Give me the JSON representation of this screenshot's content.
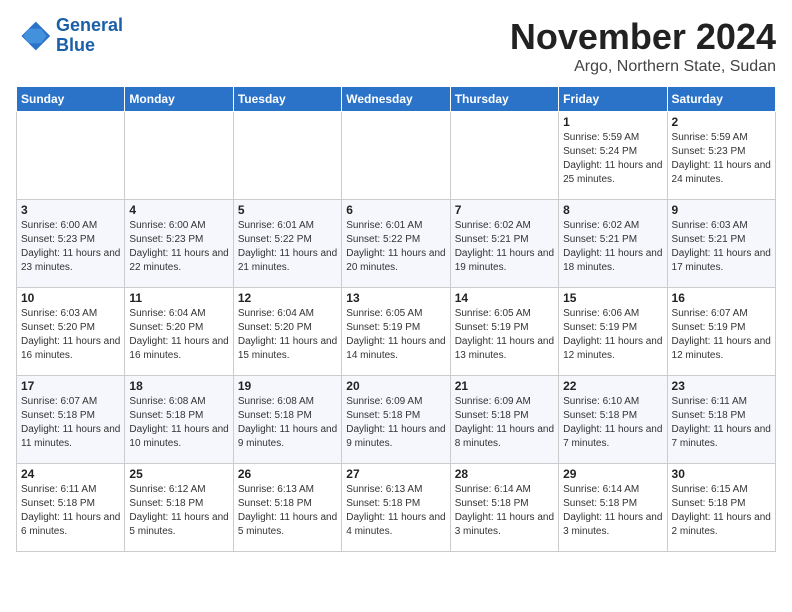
{
  "header": {
    "logo_line1": "General",
    "logo_line2": "Blue",
    "month_title": "November 2024",
    "location": "Argo, Northern State, Sudan"
  },
  "days_of_week": [
    "Sunday",
    "Monday",
    "Tuesday",
    "Wednesday",
    "Thursday",
    "Friday",
    "Saturday"
  ],
  "weeks": [
    [
      {
        "day": "",
        "info": ""
      },
      {
        "day": "",
        "info": ""
      },
      {
        "day": "",
        "info": ""
      },
      {
        "day": "",
        "info": ""
      },
      {
        "day": "",
        "info": ""
      },
      {
        "day": "1",
        "info": "Sunrise: 5:59 AM\nSunset: 5:24 PM\nDaylight: 11 hours and 25 minutes."
      },
      {
        "day": "2",
        "info": "Sunrise: 5:59 AM\nSunset: 5:23 PM\nDaylight: 11 hours and 24 minutes."
      }
    ],
    [
      {
        "day": "3",
        "info": "Sunrise: 6:00 AM\nSunset: 5:23 PM\nDaylight: 11 hours and 23 minutes."
      },
      {
        "day": "4",
        "info": "Sunrise: 6:00 AM\nSunset: 5:23 PM\nDaylight: 11 hours and 22 minutes."
      },
      {
        "day": "5",
        "info": "Sunrise: 6:01 AM\nSunset: 5:22 PM\nDaylight: 11 hours and 21 minutes."
      },
      {
        "day": "6",
        "info": "Sunrise: 6:01 AM\nSunset: 5:22 PM\nDaylight: 11 hours and 20 minutes."
      },
      {
        "day": "7",
        "info": "Sunrise: 6:02 AM\nSunset: 5:21 PM\nDaylight: 11 hours and 19 minutes."
      },
      {
        "day": "8",
        "info": "Sunrise: 6:02 AM\nSunset: 5:21 PM\nDaylight: 11 hours and 18 minutes."
      },
      {
        "day": "9",
        "info": "Sunrise: 6:03 AM\nSunset: 5:21 PM\nDaylight: 11 hours and 17 minutes."
      }
    ],
    [
      {
        "day": "10",
        "info": "Sunrise: 6:03 AM\nSunset: 5:20 PM\nDaylight: 11 hours and 16 minutes."
      },
      {
        "day": "11",
        "info": "Sunrise: 6:04 AM\nSunset: 5:20 PM\nDaylight: 11 hours and 16 minutes."
      },
      {
        "day": "12",
        "info": "Sunrise: 6:04 AM\nSunset: 5:20 PM\nDaylight: 11 hours and 15 minutes."
      },
      {
        "day": "13",
        "info": "Sunrise: 6:05 AM\nSunset: 5:19 PM\nDaylight: 11 hours and 14 minutes."
      },
      {
        "day": "14",
        "info": "Sunrise: 6:05 AM\nSunset: 5:19 PM\nDaylight: 11 hours and 13 minutes."
      },
      {
        "day": "15",
        "info": "Sunrise: 6:06 AM\nSunset: 5:19 PM\nDaylight: 11 hours and 12 minutes."
      },
      {
        "day": "16",
        "info": "Sunrise: 6:07 AM\nSunset: 5:19 PM\nDaylight: 11 hours and 12 minutes."
      }
    ],
    [
      {
        "day": "17",
        "info": "Sunrise: 6:07 AM\nSunset: 5:18 PM\nDaylight: 11 hours and 11 minutes."
      },
      {
        "day": "18",
        "info": "Sunrise: 6:08 AM\nSunset: 5:18 PM\nDaylight: 11 hours and 10 minutes."
      },
      {
        "day": "19",
        "info": "Sunrise: 6:08 AM\nSunset: 5:18 PM\nDaylight: 11 hours and 9 minutes."
      },
      {
        "day": "20",
        "info": "Sunrise: 6:09 AM\nSunset: 5:18 PM\nDaylight: 11 hours and 9 minutes."
      },
      {
        "day": "21",
        "info": "Sunrise: 6:09 AM\nSunset: 5:18 PM\nDaylight: 11 hours and 8 minutes."
      },
      {
        "day": "22",
        "info": "Sunrise: 6:10 AM\nSunset: 5:18 PM\nDaylight: 11 hours and 7 minutes."
      },
      {
        "day": "23",
        "info": "Sunrise: 6:11 AM\nSunset: 5:18 PM\nDaylight: 11 hours and 7 minutes."
      }
    ],
    [
      {
        "day": "24",
        "info": "Sunrise: 6:11 AM\nSunset: 5:18 PM\nDaylight: 11 hours and 6 minutes."
      },
      {
        "day": "25",
        "info": "Sunrise: 6:12 AM\nSunset: 5:18 PM\nDaylight: 11 hours and 5 minutes."
      },
      {
        "day": "26",
        "info": "Sunrise: 6:13 AM\nSunset: 5:18 PM\nDaylight: 11 hours and 5 minutes."
      },
      {
        "day": "27",
        "info": "Sunrise: 6:13 AM\nSunset: 5:18 PM\nDaylight: 11 hours and 4 minutes."
      },
      {
        "day": "28",
        "info": "Sunrise: 6:14 AM\nSunset: 5:18 PM\nDaylight: 11 hours and 3 minutes."
      },
      {
        "day": "29",
        "info": "Sunrise: 6:14 AM\nSunset: 5:18 PM\nDaylight: 11 hours and 3 minutes."
      },
      {
        "day": "30",
        "info": "Sunrise: 6:15 AM\nSunset: 5:18 PM\nDaylight: 11 hours and 2 minutes."
      }
    ]
  ]
}
